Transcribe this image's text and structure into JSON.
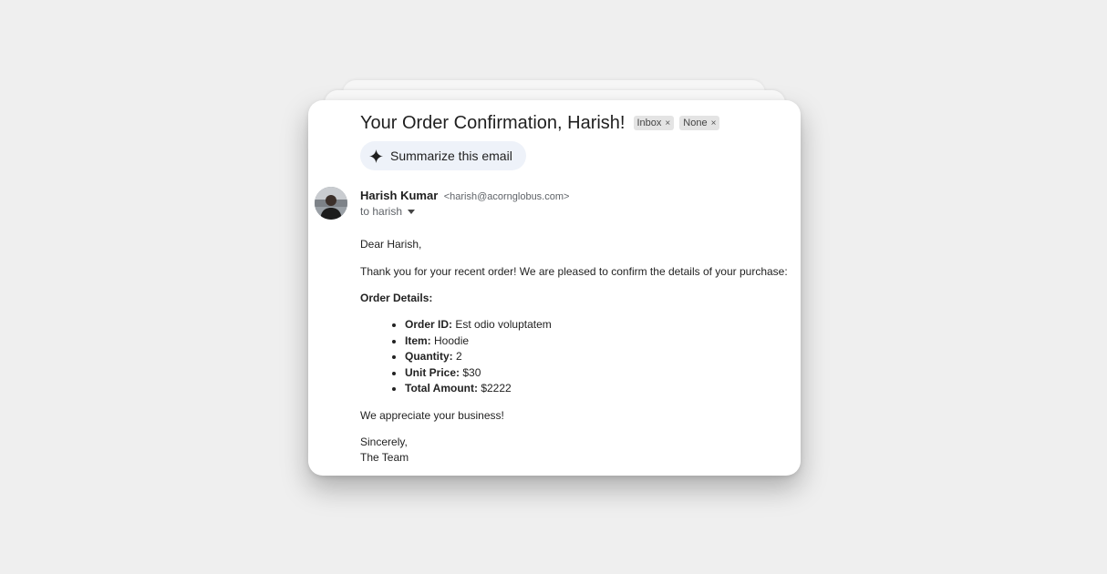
{
  "email": {
    "subject": "Your Order Confirmation, Harish!",
    "labels": [
      {
        "name": "Inbox",
        "remove_glyph": "×"
      },
      {
        "name": "None",
        "remove_glyph": "×"
      }
    ],
    "summarize_button": {
      "label": "Summarize this email",
      "icon": "sparkle-icon"
    },
    "sender": {
      "name": "Harish Kumar",
      "email": "<harish@acornglobus.com>",
      "avatar": "avatar-photo"
    },
    "recipient_line": "to harish",
    "body": {
      "greeting": "Dear Harish,",
      "intro": "Thank you for your recent order! We are pleased to confirm the details of your purchase:",
      "details_heading": "Order Details:",
      "details": [
        {
          "label": "Order ID:",
          "value": "Est odio voluptatem"
        },
        {
          "label": "Item:",
          "value": "Hoodie"
        },
        {
          "label": "Quantity:",
          "value": "2"
        },
        {
          "label": "Unit Price:",
          "value": "$30"
        },
        {
          "label": "Total Amount:",
          "value": "$2222"
        }
      ],
      "thanks": "We appreciate your business!",
      "closing": "Sincerely,",
      "signature": "The Team"
    }
  },
  "colors": {
    "background": "#efefef",
    "card": "#ffffff",
    "chip": "#e4e4e4",
    "summarize_bg": "#eef2f9",
    "muted_text": "#5f6368"
  }
}
